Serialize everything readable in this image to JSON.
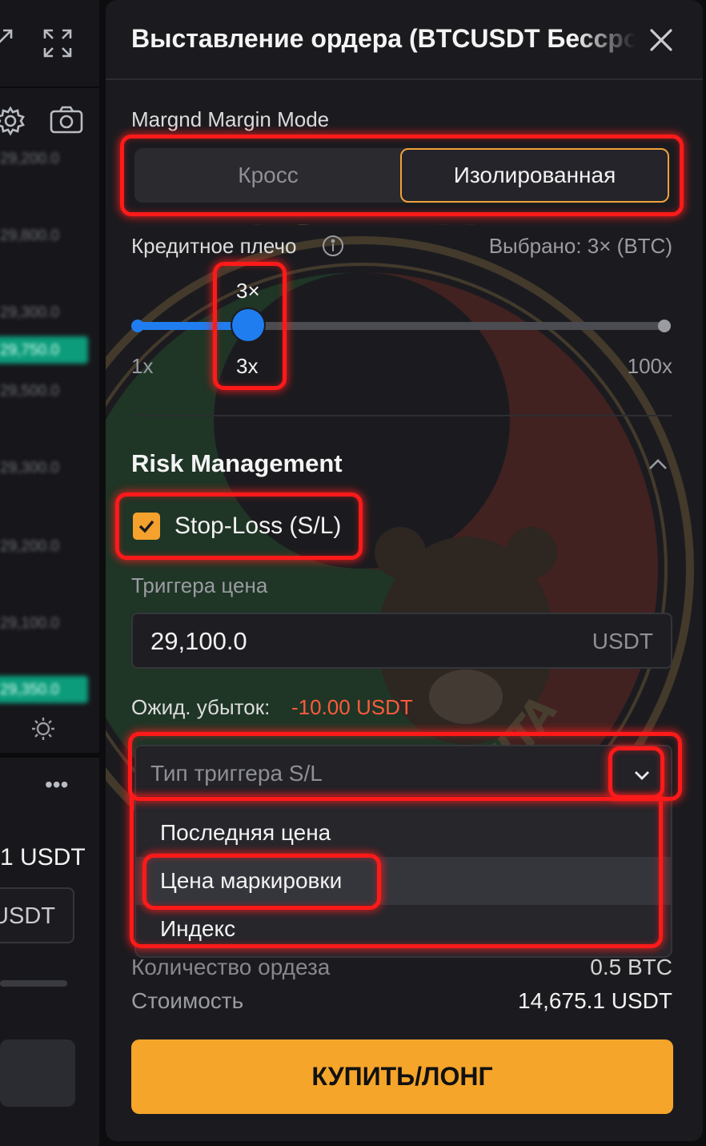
{
  "left_panel": {
    "prices": [
      "29,200.0",
      "29,800.0",
      "29,300.0",
      "29,750.0",
      "29,500.0",
      "29,300.0",
      "29,200.0",
      "29,100.0",
      "29,350.0"
    ],
    "balance": "1 USDT",
    "input_suffix": "USDT"
  },
  "modal": {
    "title": "Выставление ордера (BTCUSDT Бессрочный)",
    "margin_mode": {
      "label": "Margnd Margin Mode",
      "options": [
        "Кросс",
        "Изолированная"
      ],
      "selected": "Изолированная"
    },
    "leverage": {
      "label": "Кредитное плечо",
      "selected_text": "Выбрано: 3× (BTC)",
      "value_label_top": "3×",
      "value_label_bottom": "3x",
      "min_label": "1x",
      "max_label": "100x",
      "value": 3,
      "min": 1,
      "max": 100
    },
    "risk": {
      "title": "Risk Management",
      "stop_loss_label": "Stop-Loss (S/L)",
      "stop_loss_checked": true,
      "trigger_price_label": "Триггера цена",
      "trigger_price_value": "29,100.0",
      "trigger_price_unit": "USDT",
      "expected_loss_label": "Ожид. убыток:",
      "expected_loss_value": "-10.00 USDT",
      "trigger_type_placeholder": "Тип триггера S/L",
      "trigger_type_options": [
        "Последняя цена",
        "Цена маркировки",
        "Индекс"
      ],
      "highlighted_option": "Цена маркировки"
    },
    "summary": {
      "quantity_label": "Количество ордеза",
      "quantity_value": "0.5 BTC",
      "cost_label": "Стоимость",
      "cost_value": "14,675.1 USDT"
    },
    "buy_button": "КУПИТЬ/ЛОНГ"
  },
  "watermark": {
    "top_text": "КУЛЬТ ПРОФИТА",
    "bottom_text": "KULTPROFITA"
  },
  "colors": {
    "accent_orange": "#f5a52a",
    "slider_blue": "#1f7df0",
    "loss_red": "#ff5a3c",
    "highlight_red": "#ff1a1a",
    "background": "#1b1b1f"
  }
}
